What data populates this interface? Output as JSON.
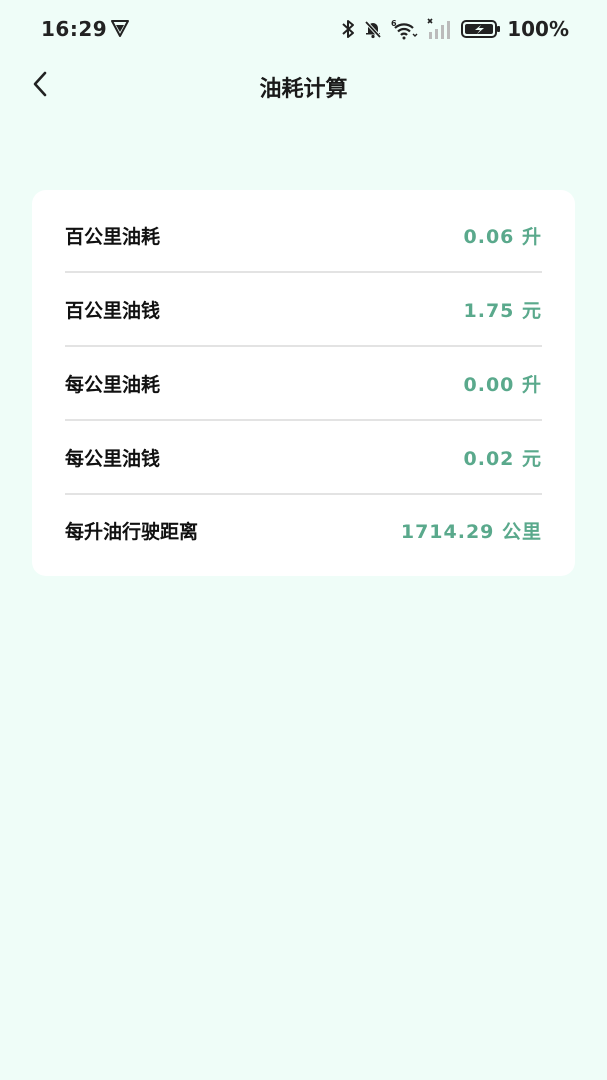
{
  "status_bar": {
    "time": "16:29",
    "battery_percent": "100%",
    "icons": [
      "shield-icon",
      "bluetooth-icon",
      "bell-muted-icon",
      "wifi-icon",
      "signal-icon",
      "battery-icon"
    ]
  },
  "header": {
    "title": "油耗计算",
    "back_icon": "chevron-left-icon"
  },
  "results": [
    {
      "label": "百公里油耗",
      "value": "0.06 升"
    },
    {
      "label": "百公里油钱",
      "value": "1.75 元"
    },
    {
      "label": "每公里油耗",
      "value": "0.00 升"
    },
    {
      "label": "每公里油钱",
      "value": "0.02 元"
    },
    {
      "label": "每升油行驶距离",
      "value": "1714.29 公里"
    }
  ],
  "colors": {
    "background": "#effdf8",
    "accent": "#5aa98c",
    "card": "#ffffff"
  }
}
